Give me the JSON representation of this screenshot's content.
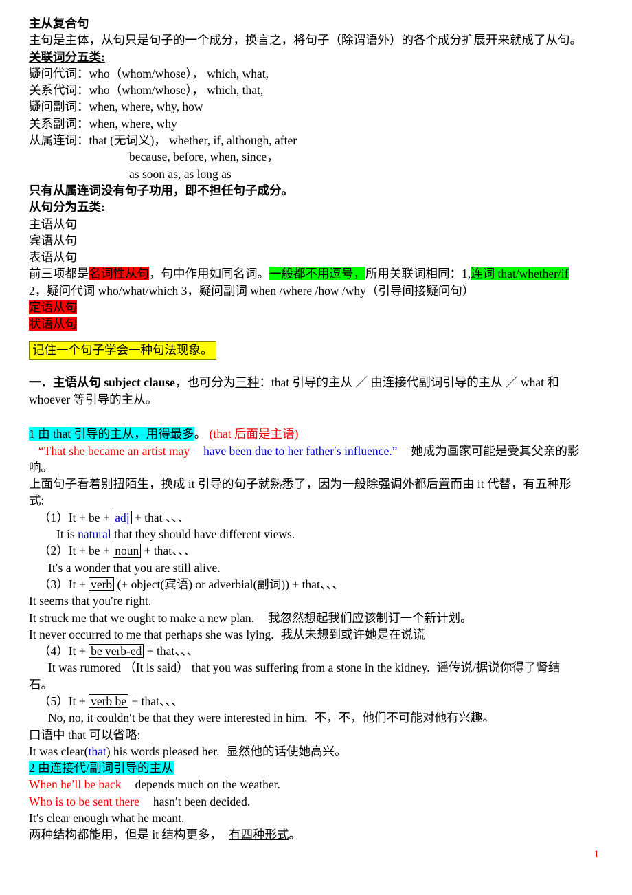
{
  "document": {
    "title": "主从复合句",
    "page_number": "1",
    "intro": "主句是主体，从句只是句子的一个成分，换言之，将句子（除谓语外）的各个成分扩展开来就成了从句。",
    "conjunction_section": {
      "heading": "关联词分五类:",
      "rows": [
        {
          "label": "疑问代词：",
          "value": "who（whom/whose），   which,   what,"
        },
        {
          "label": "关系代词：",
          "value": "who（whom/whose），   which,   that,"
        },
        {
          "label": "疑问副词：",
          "value": "when,   where,   why,   how"
        },
        {
          "label": "关系副词：",
          "value": "when,   where,   why"
        },
        {
          "label": "从属连词：",
          "value": "that (无词义)，   whether,   if,   although,   after"
        }
      ],
      "cont_line_1": "because,   before,     when,   since，",
      "cont_line_2": "as soon as,   as long as",
      "note": "只有从属连词没有句子功用，即不担任句子成分。"
    },
    "clause_types_section": {
      "heading": "从句分为五类:",
      "items": [
        "主语从句",
        "宾语从句",
        "表语从句"
      ],
      "summary": {
        "p1": "前三项都是",
        "hl_red_1": "名词性从句",
        "p2": "，句中作用如同名词。",
        "hl_green_1": "一般都不用逗号，",
        "p3": "所用关联词相同：1,",
        "hl_green_2": "连词 that/whether/if",
        "line2": "2，疑问代词 who/what/which   3，疑问副词 when /where /how /why（引导间接疑问句）"
      },
      "hl_red_items": [
        "定语从句",
        "状语从句"
      ],
      "yellow_box": "记住一个句子学会一种句法现象。"
    },
    "section_one": {
      "number": "一．",
      "title": "主语从句 subject clause",
      "text_a": "，也可分为",
      "underlined": "三种",
      "text_b": "：that 引导的主从 ／ 由连接代副词引导的主从 ／ what 和",
      "text_c": "whoever 等引导的主从。"
    },
    "sub_1": {
      "highlight": "1 由 that 引导的主从，用得最多",
      "after_hl": "。",
      "paren_red": "(that  后面是主语)",
      "example_quote_open": "“",
      "example_red": "That she became an artist may",
      "example_blue": "have been due to her father′s influence.”",
      "example_cn": "她成为画家可能是受其父亲的影",
      "example_cn2": "响。",
      "explain_1": "上面句子看着别扭陌生，换成 it 引导的句子就熟悉了，因为一般除强调外都后置而由 it 代替，",
      "explain_underlined": "有五种形",
      "explain_2": "式:",
      "patterns": [
        {
          "label": "（1）It + be +",
          "boxed": "adj",
          "boxed_color": "blue",
          "tail": "+ that  、、、",
          "examples": [
            {
              "pre": "It is ",
              "blue": "natural",
              "post": " that they should have different views.",
              "cn": ""
            }
          ]
        },
        {
          "label": "（2）It + be +",
          "boxed": "noun",
          "boxed_color": "black",
          "tail": "+ that、、、",
          "examples": [
            {
              "pre": "It′s a wonder that you are still alive.",
              "blue": "",
              "post": "",
              "cn": ""
            }
          ]
        },
        {
          "label": "（3）It +",
          "boxed": "verb",
          "boxed_color": "black",
          "tail": "(+ object(宾语) or adverbial(副词)) + that、、、",
          "examples": [
            {
              "pre": "It seems that you′re right.",
              "blue": "",
              "post": "",
              "cn": ""
            },
            {
              "pre": "It struck me that we ought to make a new plan.",
              "blue": "",
              "post": "",
              "cn": "我忽然想起我们应该制订一个新计划。"
            },
            {
              "pre": "It never occurred to me that perhaps she was lying.",
              "blue": "",
              "post": "",
              "cn": "我从未想到或许她是在说谎"
            }
          ]
        },
        {
          "label": "（4）It +",
          "boxed": "be verb-ed",
          "boxed_color": "black",
          "tail": "+ that、、、",
          "examples": [
            {
              "pre": "It was rumored （It is said） that you was suffering from a stone in the kidney.",
              "blue": "",
              "post": "",
              "cn": "谣传说/据说你得了肾结"
            },
            {
              "pre": "石。",
              "blue": "",
              "post": "",
              "cn": ""
            }
          ]
        },
        {
          "label": "（5）It +",
          "boxed": "verb be",
          "boxed_color": "black",
          "tail": "+ that、、、",
          "examples": [
            {
              "pre": "No, no, it couldn′t be that they were interested in him.",
              "blue": "",
              "post": "",
              "cn": "不，不，他们不可能对他有兴趣。"
            }
          ]
        }
      ],
      "omit_note": "口语中 that 可以省略:",
      "omit_example_pre": "It was clear(",
      "omit_example_blue": "that",
      "omit_example_post": ") his words pleased her.",
      "omit_example_cn": "显然他的话使她高兴。"
    },
    "sub_2": {
      "highlight_num": "2 由",
      "highlight_underlined": "连接代/副词",
      "highlight_rest": "引导的主从",
      "lines": [
        {
          "red": "When he′ll be back",
          "black": "depends much on the weather."
        },
        {
          "red": "Who is to be sent there",
          "black": "hasn′t been decided."
        },
        {
          "red": "",
          "black": "It′s clear enough what he meant."
        }
      ],
      "closing_pre": "两种结构都能用，但是 it 结构更多，",
      "closing_underlined": "有四种形式",
      "closing_post": "。"
    }
  }
}
